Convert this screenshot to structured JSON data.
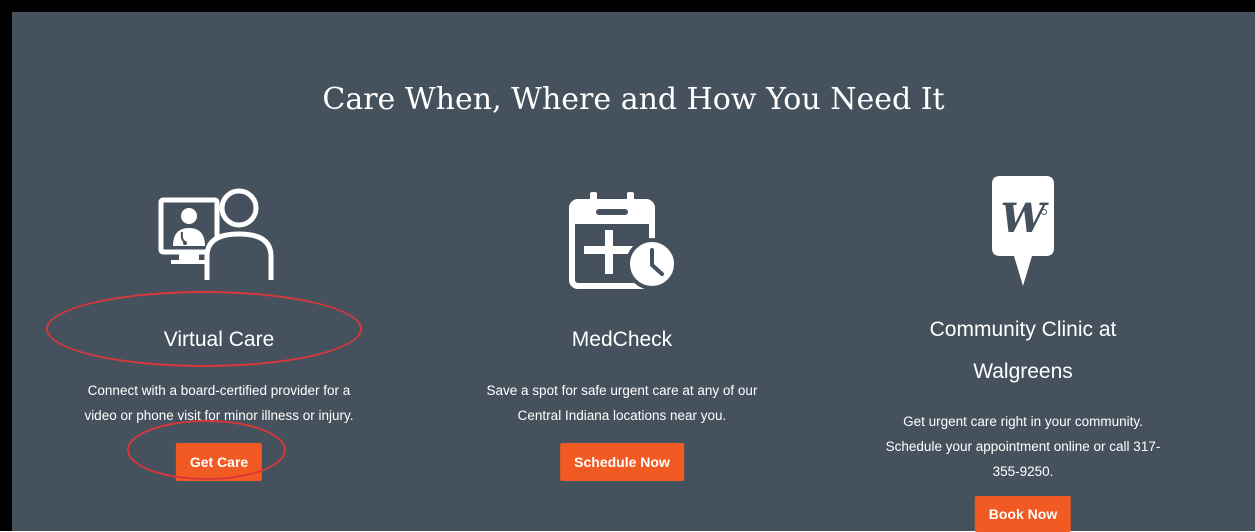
{
  "section": {
    "heading": "Care When, Where and How You Need It"
  },
  "cards": [
    {
      "title": "Virtual Care",
      "description_line1": "Connect with a board-certified provider for a",
      "description_line2": "video or phone visit for minor illness or injury.",
      "button_label": "Get Care",
      "icon": "telehealth-doctor-icon"
    },
    {
      "title": "MedCheck",
      "description_line1": "Save a spot for safe urgent care at any of our",
      "description_line2": "Central Indiana locations near you.",
      "button_label": "Schedule Now",
      "icon": "calendar-clock-icon"
    },
    {
      "title_line1": "Community Clinic at",
      "title_line2": "Walgreens",
      "description_line1": "Get urgent care right in your community.",
      "description_line2": "Schedule your appointment online or call 317-",
      "description_line3": "355-9250.",
      "button_label": "Book Now",
      "icon": "walgreens-logo-icon"
    }
  ],
  "colors": {
    "background": "#45515d",
    "button": "#f15a22",
    "annotation": "#d9383a"
  }
}
